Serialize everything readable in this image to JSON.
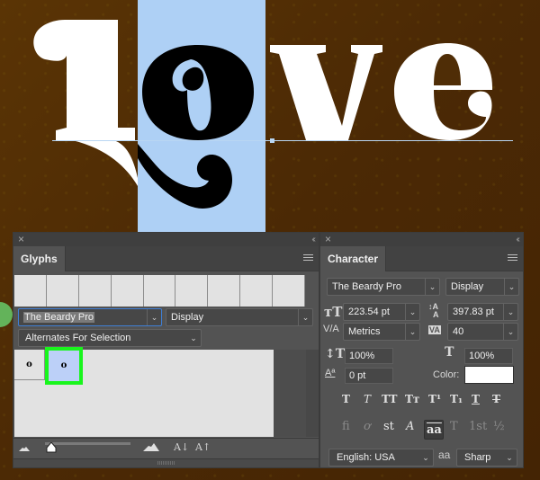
{
  "canvas": {
    "text": "love",
    "highlighted_glyph": "o",
    "background_color": "#4a2a06",
    "selection_color": "#aed0f5",
    "text_color": "#ffffff"
  },
  "glyphs_panel": {
    "close_icon": "×",
    "collapse_icon": "‹‹",
    "tab_label": "Glyphs",
    "font_family": "The Beardy Pro",
    "font_style": "Display",
    "filter": "Alternates For Selection",
    "glyph_cells": [
      {
        "glyph": "o",
        "selected": false
      },
      {
        "glyph": "o",
        "selected": true
      }
    ],
    "footer": {
      "decrease_size_icon": "small-mountain-icon",
      "increase_size_icon": "large-mountain-icon",
      "zoom_level": 0.1,
      "decrease_font_label": "A↓",
      "increase_font_label": "A↑"
    }
  },
  "character_panel": {
    "close_icon": "×",
    "collapse_icon": "‹‹",
    "tab_label": "Character",
    "font_family": "The Beardy Pro",
    "font_style": "Display",
    "font_size": "223.54 pt",
    "leading": "397.83 pt",
    "kerning": "Metrics",
    "tracking": "40",
    "vertical_scale": "100%",
    "horizontal_scale": "100%",
    "baseline_shift": "0 pt",
    "color_label": "Color:",
    "color_value": "#ffffff",
    "style_buttons": [
      "T",
      "T",
      "TT",
      "Tт",
      "T¹",
      "T₁",
      "T",
      "T"
    ],
    "opentype_buttons": [
      "fi",
      "ơ",
      "st",
      "A",
      "aa",
      "T",
      "1st",
      "½"
    ],
    "language": "English: USA",
    "aa_icon_label": "aa",
    "antialias": "Sharp"
  }
}
